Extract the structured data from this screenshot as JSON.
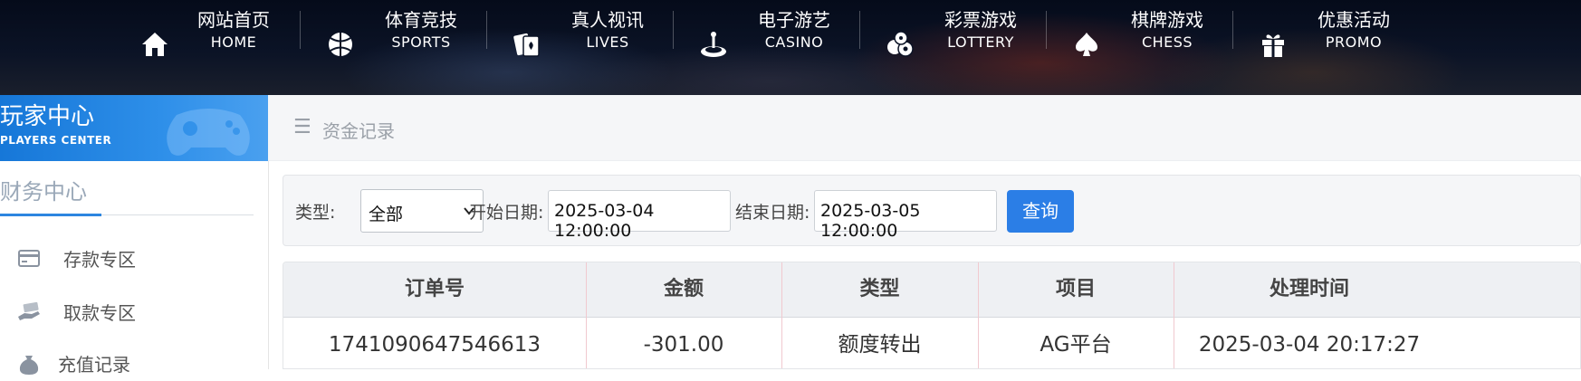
{
  "nav": {
    "items": [
      {
        "cn": "网站首页",
        "en": "HOME",
        "icon": "home-icon"
      },
      {
        "cn": "体育竞技",
        "en": "SPORTS",
        "icon": "basketball-icon"
      },
      {
        "cn": "真人视讯",
        "en": "LIVES",
        "icon": "cards-icon"
      },
      {
        "cn": "电子游艺",
        "en": "CASINO",
        "icon": "roulette-icon"
      },
      {
        "cn": "彩票游戏",
        "en": "LOTTERY",
        "icon": "lottery-balls-icon"
      },
      {
        "cn": "棋牌游戏",
        "en": "CHESS",
        "icon": "spade-icon"
      },
      {
        "cn": "优惠活动",
        "en": "PROMO",
        "icon": "gift-icon"
      }
    ]
  },
  "sidebar": {
    "header_title": "玩家中心",
    "header_sub": "PLAYERS CENTER",
    "section": "财务中心",
    "items": [
      {
        "label": "存款专区",
        "icon": "card-icon"
      },
      {
        "label": "取款专区",
        "icon": "cash-hand-icon"
      },
      {
        "label": "充值记录",
        "icon": "money-bag-icon"
      }
    ]
  },
  "breadcrumb": {
    "label": "资金记录",
    "icon": "menu-icon"
  },
  "filter": {
    "type_label": "类型:",
    "type_value": "全部",
    "start_label": "开始日期:",
    "start_value": "2025-03-04 12:00:00",
    "end_label": "结束日期:",
    "end_value": "2025-03-05 12:00:00",
    "query_label": "查询"
  },
  "table": {
    "headers": [
      "订单号",
      "金额",
      "类型",
      "项目",
      "处理时间"
    ],
    "rows": [
      [
        "1741090647546613",
        "-301.00",
        "额度转出",
        "AG平台",
        "2025-03-04 20:17:27"
      ]
    ]
  },
  "colors": {
    "accent": "#2b7ee6",
    "sidebar_header": "#1677d8"
  }
}
